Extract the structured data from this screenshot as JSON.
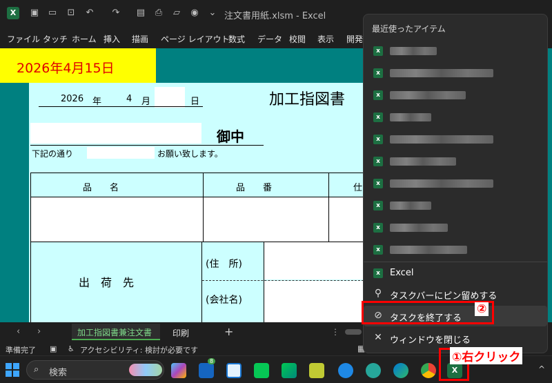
{
  "window": {
    "title": "注文書用紙.xlsm  -  Excel"
  },
  "ribbon_tabs": [
    "ファイル",
    "タッチ",
    "ホーム",
    "挿入",
    "描画",
    "ページ レイアウト",
    "数式",
    "データ",
    "校閲",
    "表示",
    "開発"
  ],
  "sheet": {
    "date_cell": "2026年4月15日",
    "form": {
      "year": "2026",
      "year_unit": "年",
      "month": "4",
      "month_unit": "月",
      "day_unit": "日",
      "title": "加工指図書",
      "recipient_suffix": "御中",
      "request_prefix": "下記の通り",
      "request_suffix": "お願い致します。",
      "header_product_name": "品　　名",
      "header_product_number": "品　　番",
      "header_partial": "仕",
      "ship_to": "出　荷　先",
      "address_label": "(住　所)",
      "company_label": "(会社名)",
      "bottom_partial_1": "",
      "bottom_partial_2": "",
      "bottom_partial_3": ""
    }
  },
  "sheet_tabs": {
    "active": "加工指図書兼注文書",
    "other": "印刷",
    "add": "+"
  },
  "status": {
    "ready": "準備完了",
    "accessibility": "アクセシビリティ: 検討が必要です"
  },
  "taskbar": {
    "search_placeholder": "検索",
    "badge_count": "8"
  },
  "context_menu": {
    "header": "最近使ったアイテム",
    "recent_count": 10,
    "app_name": "Excel",
    "pin_label": "タスクバーにピン留めする",
    "end_task_label": "タスクを終了する",
    "close_window_label": "ウィンドウを閉じる"
  },
  "annotations": {
    "step1": "①右クリック",
    "step2": "②"
  },
  "colors": {
    "sheet_bg": "#008080",
    "form_bg": "#ccffff",
    "date_cell_bg": "#ffff00",
    "date_text": "#e00000",
    "annotation_red": "#ff0000",
    "excel_green": "#1d6f42"
  }
}
